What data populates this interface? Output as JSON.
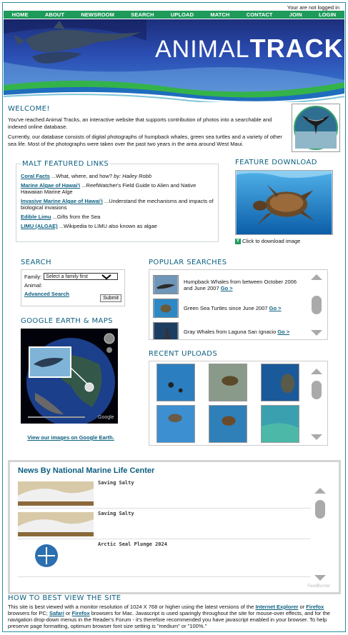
{
  "login_status": "Your are not logged in",
  "nav": [
    "HOME",
    "ABOUT",
    "NEWSROOM",
    "SEARCH",
    "UPLOAD",
    "MATCH",
    "CONTACT",
    "JOIN",
    "LOGIN"
  ],
  "banner": {
    "title_light": "ANIMAL",
    "title_bold": "TRACKS"
  },
  "welcome": {
    "heading": "WELCOME!",
    "p1": "You've reached Animal Tracks, an interactive website that supports contribution of photos into a searchable and indexed online database.",
    "p2": "Currently, our database consists of digital photographs of humpback whales, green sea turtles and a variety of other sea life. Most of the photographs were taken over the past two years in the area around West Maui."
  },
  "featured": {
    "heading": "MALT FEATURED LINKS",
    "links": [
      {
        "title": "Coral Facts",
        "desc": "...What, where, and how?",
        "by": " by: Hailey Robb"
      },
      {
        "title": "Marine Algae of Hawai'i",
        "desc": "...ReefWatcher's Field Guide to Alien and Native Hawaiian Marine Alge"
      },
      {
        "title": "Invasive Marine Algae of Hawai'i",
        "desc": "...Understand the mechanisms and impacts of biological invasions"
      },
      {
        "title": "Edible Limu",
        "desc": "...Gifts from the Sea"
      },
      {
        "title": "LIMU (ALGAE)",
        "desc": "...Wikipedia to LIMU also known as algae"
      }
    ]
  },
  "feature_download": {
    "heading": "FEATURE DOWNLOAD",
    "caption": "Click to download image"
  },
  "search": {
    "heading": "SEARCH",
    "family_label": "Family:",
    "family_value": "Select a family first",
    "animal_label": "Animal:",
    "advanced": "Advanced Search",
    "submit": "Submit"
  },
  "google_earth": {
    "heading": "GOOGLE EARTH & MAPS",
    "link": "View our images on Google Earth."
  },
  "popular": {
    "heading": "POPULAR SEARCHES",
    "items": [
      {
        "text": "Humpback Whales from between October 2006 and June 2007",
        "go": "Go >"
      },
      {
        "text": "Green Sea Turtles since June 2007",
        "go": "Go >"
      },
      {
        "text": "Gray Whales from Laguna San Ignacio",
        "go": "Go >"
      }
    ]
  },
  "recent": {
    "heading": "RECENT UPLOADS"
  },
  "news": {
    "heading": "News By National Marine Life Center",
    "items": [
      "Saving Salty",
      "Saving Salty",
      "Arctic Seal Plunge 2024"
    ],
    "footer": "FeedBurner"
  },
  "howto": {
    "heading": "HOW TO BEST VIEW THE SITE",
    "t1": "This site is best viewed with a monitor resolution of 1024 X 768 or higher using the latest versions of the ",
    "ie": "Internet Explorer",
    "or1": " or ",
    "ff1": "Firefox",
    "t2": " browsers for PC; ",
    "safari": "Safari",
    "or2": " or ",
    "ff2": "Firefox",
    "t3": " browsers for Mac. Javascript is used sparingly throughout the site for mouse-over effects, and for the navigation drop-down menus in the Reader's Forum - it's therefore recommended you have javascript enabled in your browser. To help preserve page formatting, optimum browser font size setting is \"medium\" or \"100%.\""
  }
}
